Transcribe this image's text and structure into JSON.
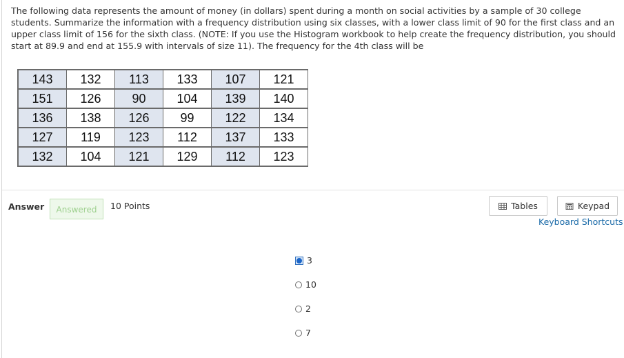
{
  "question": {
    "text": "The following data represents the amount of money (in dollars) spent during a month on social activities by a sample of 30 college students. Summarize the information with a frequency distribution using six classes, with a lower class limit of 90 for the first class and an upper class limit of 156 for the sixth class. (NOTE: If you use the Histogram workbook to help create the frequency distribution, you should start at 89.9 and end at 155.9 with intervals of size 11). The frequency for the 4th class will be"
  },
  "data_table": {
    "rows": [
      [
        "143",
        "132",
        "113",
        "133",
        "107",
        "121"
      ],
      [
        "151",
        "126",
        "90",
        "104",
        "139",
        "140"
      ],
      [
        "136",
        "138",
        "126",
        "99",
        "122",
        "134"
      ],
      [
        "127",
        "119",
        "123",
        "112",
        "137",
        "133"
      ],
      [
        "132",
        "104",
        "121",
        "129",
        "112",
        "123"
      ]
    ]
  },
  "answer": {
    "label": "Answer",
    "status": "Answered",
    "points": "10 Points"
  },
  "tools": {
    "tables_label": "Tables",
    "keypad_label": "Keypad",
    "shortcuts_label": "Keyboard Shortcuts"
  },
  "options": [
    {
      "label": "3",
      "selected": true
    },
    {
      "label": "10",
      "selected": false
    },
    {
      "label": "2",
      "selected": false
    },
    {
      "label": "7",
      "selected": false
    }
  ],
  "colors": {
    "link": "#1a6aa8",
    "answered_text": "#9ed08f",
    "answered_bg": "#eef8eb",
    "radio_selected": "#1c66c9",
    "table_shade": "#dfe5ef"
  },
  "icons": {
    "tables": "table-grid-icon",
    "keypad": "keypad-icon"
  }
}
